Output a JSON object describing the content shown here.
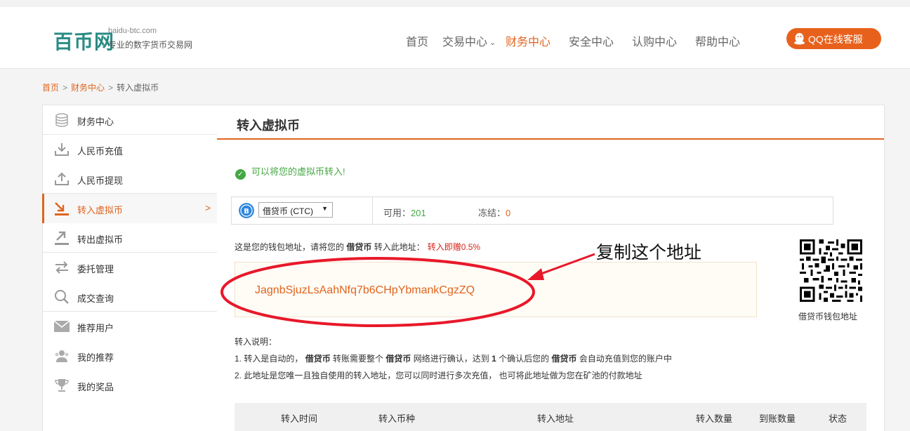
{
  "header": {
    "logo_mark": "百币网",
    "logo_domain": "baidu-btc.com",
    "logo_slogan": "专业的数字货币交易网",
    "nav": [
      "首页",
      "交易中心",
      "财务中心",
      "安全中心",
      "认购中心",
      "帮助中心"
    ],
    "active_nav": "财务中心",
    "qq_button": "QQ在线客服"
  },
  "breadcrumb": {
    "home": "首页",
    "sep": ">",
    "section": "财务中心",
    "current": "转入虚拟币"
  },
  "sidebar": {
    "items": [
      {
        "label": "财务中心",
        "icon": "coins-icon"
      },
      {
        "label": "人民币充值",
        "icon": "download-icon"
      },
      {
        "label": "人民币提现",
        "icon": "upload-icon"
      },
      {
        "label": "转入虚拟币",
        "icon": "transfer-in-icon",
        "active": true
      },
      {
        "label": "转出虚拟币",
        "icon": "transfer-out-icon"
      },
      {
        "label": "委托管理",
        "icon": "exchange-arrows-icon"
      },
      {
        "label": "成交查询",
        "icon": "search-icon"
      },
      {
        "label": "推荐用户",
        "icon": "mail-icon"
      },
      {
        "label": "我的推荐",
        "icon": "users-icon"
      },
      {
        "label": "我的奖品",
        "icon": "trophy-icon"
      }
    ],
    "arrow": ">"
  },
  "main": {
    "title": "转入虚拟币",
    "notice": "可以将您的虚拟币转入!",
    "coin_select": "借贷币 (CTC)",
    "available_label": "可用：",
    "available_value": "201",
    "frozen_label": "冻结：",
    "frozen_value": "0",
    "addr_hint_prefix": "这是您的钱包地址，请将您的",
    "addr_hint_coin": "借贷币",
    "addr_hint_suffix": "转入此地址：",
    "addr_bonus": "转入即赠0.5%",
    "wallet_address": "JagnbSjuzLsAahNfq7b6CHpYbmankCgzZQ",
    "annotation": "复制这个地址",
    "qr_label": "借贷币钱包地址",
    "notes_title": "转入说明：",
    "note1": {
      "p1": "1. 转入是自动的，",
      "coin1": "借贷币",
      "p2": "转账需要整个",
      "coin2": "借贷币",
      "p3": "网络进行确认，达到",
      "count": "1",
      "p4": "个确认后您的",
      "coin3": "借贷币",
      "p5": "会自动充值到您的账户中"
    },
    "note2": "2. 此地址是您唯一且独自使用的转入地址，您可以同时进行多次充值， 也可将此地址做为您在矿池的付款地址"
  },
  "table": {
    "headers": [
      "转入时间",
      "转入币种",
      "转入地址",
      "转入数量",
      "到账数量",
      "状态"
    ]
  },
  "colors": {
    "accent": "#e0641e",
    "success": "#46a744",
    "brand_teal": "#2a8c84",
    "annotation_red": "#e8182a"
  }
}
